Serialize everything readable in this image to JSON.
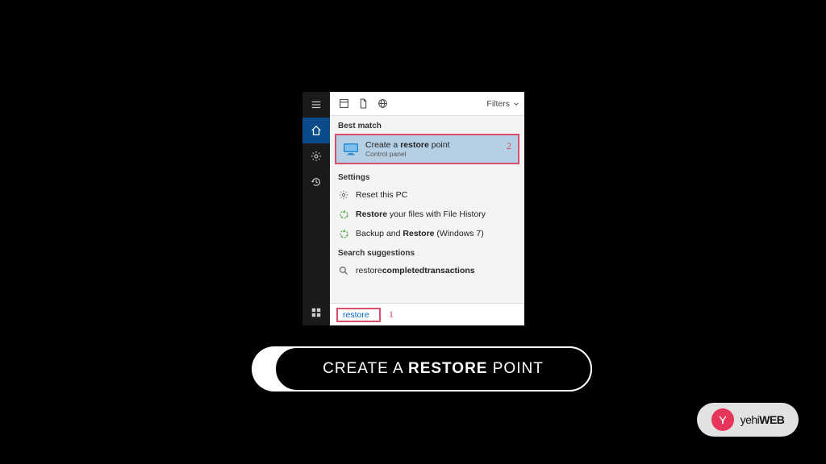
{
  "sidebar": {
    "items": [
      {
        "name": "menu-icon"
      },
      {
        "name": "home-icon",
        "active": true
      },
      {
        "name": "gear-icon"
      },
      {
        "name": "history-icon"
      }
    ],
    "bottom": {
      "name": "windows-icon"
    }
  },
  "header": {
    "tabs": [
      "collection-icon",
      "document-icon",
      "web-icon"
    ],
    "filters_label": "Filters"
  },
  "sections": {
    "best_match_title": "Best match",
    "settings_title": "Settings",
    "suggestions_title": "Search suggestions"
  },
  "best_match": {
    "title_pre": "Create a ",
    "title_bold": "restore",
    "title_post": " point",
    "subtitle": "Control panel",
    "annotation": "2"
  },
  "settings_items": [
    {
      "icon": "gear",
      "pre": "Reset this PC",
      "bold": "",
      "post": ""
    },
    {
      "icon": "recycle",
      "pre": "",
      "bold": "Restore",
      "post": " your files with File History"
    },
    {
      "icon": "recycle",
      "pre": "Backup and ",
      "bold": "Restore",
      "post": " (Windows 7)"
    }
  ],
  "suggestions": [
    {
      "icon": "search",
      "pre": "restore",
      "bold": "completedtransactions"
    }
  ],
  "search": {
    "value": "restore",
    "annotation": "1"
  },
  "caption": {
    "pre": "CREATE A ",
    "bold": "RESTORE",
    "post": " POINT"
  },
  "badge": {
    "glyph": "Y",
    "text_light": "yehi",
    "text_bold": "WEB"
  },
  "colors": {
    "highlight": "#d94f6a",
    "selected_bg": "#b5cfe4",
    "badge_accent": "#e63558"
  }
}
